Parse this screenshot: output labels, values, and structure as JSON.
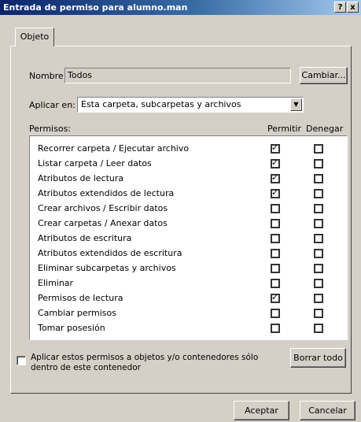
{
  "window": {
    "title": "Entrada de permiso para alumno.man",
    "help_label": "?",
    "close_label": "x"
  },
  "tabs": [
    {
      "label": "Objeto"
    }
  ],
  "name": {
    "label": "Nombre:",
    "value": "Todos",
    "change_button": "Cambiar..."
  },
  "apply_on": {
    "label": "Aplicar en:",
    "selected": "Esta carpeta, subcarpetas y archivos"
  },
  "permissions": {
    "label": "Permisos:",
    "allow_header": "Permitir",
    "deny_header": "Denegar",
    "items": [
      {
        "name": "Recorrer carpeta / Ejecutar archivo",
        "allow": true,
        "deny": false
      },
      {
        "name": "Listar carpeta / Leer datos",
        "allow": true,
        "deny": false
      },
      {
        "name": "Atributos de lectura",
        "allow": true,
        "deny": false
      },
      {
        "name": "Atributos extendidos de lectura",
        "allow": true,
        "deny": false
      },
      {
        "name": "Crear archivos / Escribir datos",
        "allow": false,
        "deny": false
      },
      {
        "name": "Crear carpetas / Anexar datos",
        "allow": false,
        "deny": false
      },
      {
        "name": "Atributos de escritura",
        "allow": false,
        "deny": false
      },
      {
        "name": "Atributos extendidos de escritura",
        "allow": false,
        "deny": false
      },
      {
        "name": "Eliminar subcarpetas y archivos",
        "allow": false,
        "deny": false
      },
      {
        "name": "Eliminar",
        "allow": false,
        "deny": false
      },
      {
        "name": "Permisos de lectura",
        "allow": true,
        "deny": false
      },
      {
        "name": "Cambiar permisos",
        "allow": false,
        "deny": false
      },
      {
        "name": "Tomar posesión",
        "allow": false,
        "deny": false
      }
    ]
  },
  "apply_inherit": {
    "line1": "Aplicar estos permisos a objetos y/o contenedores sólo",
    "line2": "dentro de este contenedor",
    "checked": false
  },
  "buttons": {
    "clear_all": "Borrar todo",
    "ok": "Aceptar",
    "cancel": "Cancelar"
  }
}
